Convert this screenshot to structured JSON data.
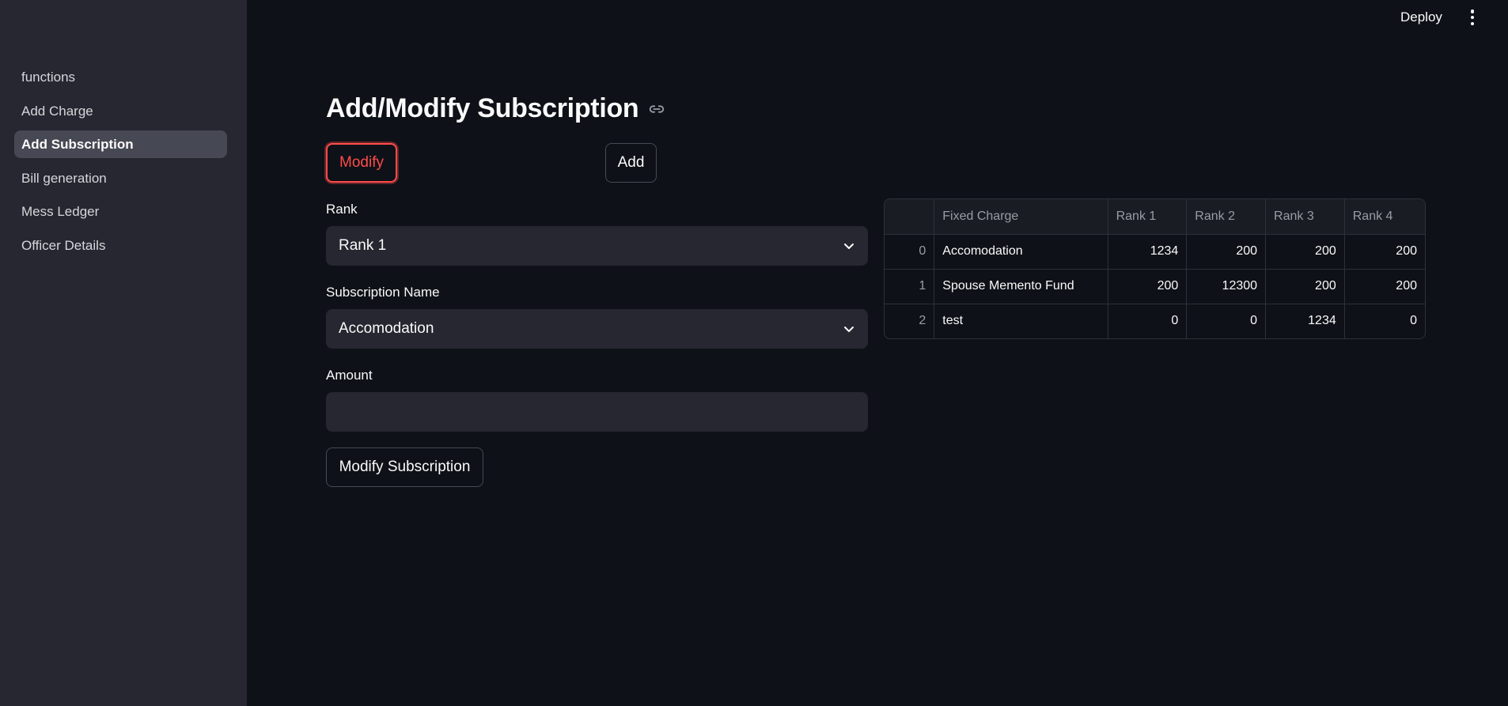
{
  "sidebar": {
    "items": [
      {
        "label": "functions"
      },
      {
        "label": "Add Charge"
      },
      {
        "label": "Add Subscription",
        "active": true
      },
      {
        "label": "Bill generation"
      },
      {
        "label": "Mess Ledger"
      },
      {
        "label": "Officer Details"
      }
    ]
  },
  "header": {
    "deploy_label": "Deploy",
    "menu_icon": "vertical-dots-icon"
  },
  "main": {
    "title": "Add/Modify Subscription",
    "title_icon": "link-icon",
    "modify_label": "Modify",
    "add_label": "Add",
    "rank": {
      "label": "Rank",
      "value": "Rank 1"
    },
    "subscription": {
      "label": "Subscription Name",
      "value": "Accomodation"
    },
    "amount": {
      "label": "Amount",
      "value": ""
    },
    "submit_label": "Modify Subscription",
    "accent_color": "#ff4b4b"
  },
  "table": {
    "columns": [
      "",
      "Fixed Charge",
      "Rank 1",
      "Rank 2",
      "Rank 3",
      "Rank 4"
    ],
    "rows": [
      [
        "0",
        "Accomodation",
        "1234",
        "200",
        "200",
        "200"
      ],
      [
        "1",
        "Spouse Memento Fund",
        "200",
        "12300",
        "200",
        "200"
      ],
      [
        "2",
        "test",
        "0",
        "0",
        "1234",
        "0"
      ]
    ]
  }
}
